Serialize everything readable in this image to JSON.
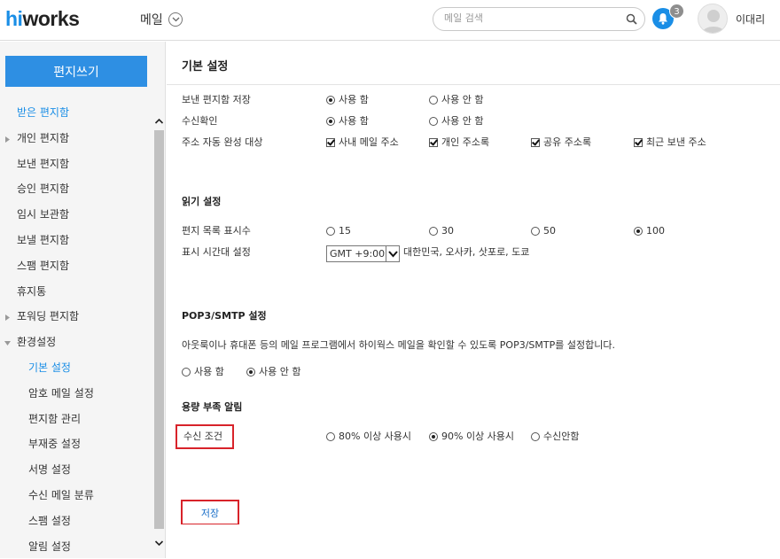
{
  "header": {
    "logo_hi": "hi",
    "logo_rest": "works",
    "app_menu": "메일",
    "search_placeholder": "메일 검색",
    "notification_count": "3",
    "username": "이대리"
  },
  "sidebar": {
    "compose_label": "편지쓰기",
    "items": [
      {
        "label": "받은 편지함",
        "level": "top",
        "active": true
      },
      {
        "label": "개인 편지함",
        "level": "top",
        "expander": true
      },
      {
        "label": "보낸 편지함",
        "level": "top"
      },
      {
        "label": "승인 편지함",
        "level": "top"
      },
      {
        "label": "임시 보관함",
        "level": "top"
      },
      {
        "label": "보낼 편지함",
        "level": "top"
      },
      {
        "label": "스팸 편지함",
        "level": "top"
      },
      {
        "label": "휴지통",
        "level": "top"
      },
      {
        "label": "포워딩 편지함",
        "level": "top",
        "expander": true
      },
      {
        "label": "환경설정",
        "level": "top",
        "expanded": true
      },
      {
        "label": "기본 설정",
        "level": "sub",
        "active": true
      },
      {
        "label": "암호 메일 설정",
        "level": "sub"
      },
      {
        "label": "편지함 관리",
        "level": "sub"
      },
      {
        "label": "부재중 설정",
        "level": "sub"
      },
      {
        "label": "서명 설정",
        "level": "sub"
      },
      {
        "label": "수신 메일 분류",
        "level": "sub"
      },
      {
        "label": "스팸 설정",
        "level": "sub"
      },
      {
        "label": "알림 설정",
        "level": "sub"
      }
    ]
  },
  "main": {
    "title": "기본 설정",
    "basic": {
      "save_sent_label": "보낸 편지함 저장",
      "save_sent_opts": [
        "사용 함",
        "사용 안 함"
      ],
      "receipt_label": "수신확인",
      "receipt_opts": [
        "사용 함",
        "사용 안 함"
      ],
      "autocomplete_label": "주소 자동 완성 대상",
      "autocomplete_opts": [
        "사내 메일 주소",
        "개인 주소록",
        "공유 주소록",
        "최근 보낸 주소"
      ]
    },
    "read": {
      "title": "읽기 설정",
      "list_count_label": "편지 목록 표시수",
      "list_count_opts": [
        "15",
        "30",
        "50",
        "100"
      ],
      "timezone_label": "표시 시간대 설정",
      "timezone_value": "GMT +9:00",
      "timezone_desc": "대한민국, 오사카, 삿포로, 도쿄"
    },
    "pop3": {
      "title": "POP3/SMTP 설정",
      "desc": "아웃룩이나 휴대폰 등의 메일 프로그램에서 하이웍스 메일을 확인할 수 있도록 POP3/SMTP를 설정합니다.",
      "opts": [
        "사용 함",
        "사용 안 함"
      ]
    },
    "capacity": {
      "title": "용량 부족 알림",
      "condition_label": "수신 조건",
      "opts": [
        "80% 이상 사용시",
        "90% 이상 사용시",
        "수신안함"
      ]
    },
    "save_label": "저장"
  }
}
